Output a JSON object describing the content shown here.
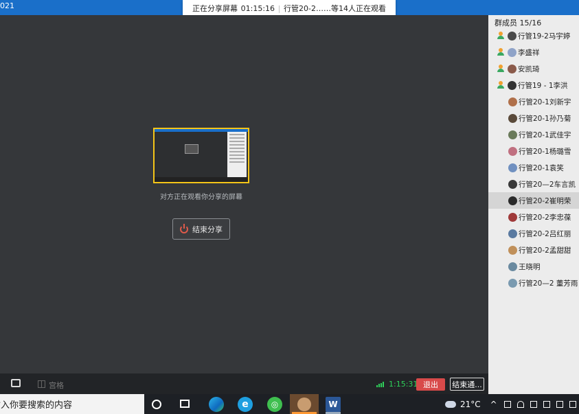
{
  "window": {
    "title_fragment": "021"
  },
  "share_banner": {
    "status": "正在分享屏幕",
    "elapsed": "01:15:16",
    "viewers": "行管20-2……等14人正在观看"
  },
  "stage": {
    "watch_text": "对方正在观看你分享的屏幕",
    "end_share_label": "结束分享"
  },
  "controlbar": {
    "grid_label": "宫格",
    "timer": "1:15:31",
    "leave_label": "退出",
    "end_all_label": "结束通..."
  },
  "sidebar": {
    "header": "群成员 15/16",
    "members": [
      {
        "name": "行管19-2马宇婷",
        "host": true,
        "color": "#4a4a4a"
      },
      {
        "name": "李盛祥",
        "host": true,
        "color": "#8fa3c8"
      },
      {
        "name": "安凯琦",
        "host": true,
        "color": "#8a5a4a"
      },
      {
        "name": "行管19 - 1李洪",
        "host": true,
        "color": "#333333"
      },
      {
        "name": "行管20-1刘新宇",
        "host": false,
        "color": "#b0704a"
      },
      {
        "name": "行管20-1孙乃菊",
        "host": false,
        "color": "#5a4a3a"
      },
      {
        "name": "行管20-1武佳宇",
        "host": false,
        "color": "#6a7a5a"
      },
      {
        "name": "行管20-1杨璐雪",
        "host": false,
        "color": "#c07080"
      },
      {
        "name": "行管20-1袁笑",
        "host": false,
        "color": "#7090c0"
      },
      {
        "name": "行管20—2车言凯",
        "host": false,
        "color": "#3a3a3a"
      },
      {
        "name": "行管20-2崔明荣",
        "host": false,
        "color": "#2a2a2a",
        "selected": true
      },
      {
        "name": "行管20-2李忠葆",
        "host": false,
        "color": "#a03a3a"
      },
      {
        "name": "行管20-2吕红丽",
        "host": false,
        "color": "#5a7aa0"
      },
      {
        "name": "行管20-2孟甜甜",
        "host": false,
        "color": "#c0905a"
      },
      {
        "name": "王晓明",
        "host": false,
        "color": "#6a8aa0"
      },
      {
        "name": "行管20—2 董芳雨",
        "host": false,
        "color": "#7a9ab0"
      }
    ]
  },
  "taskbar": {
    "search_placeholder": "输入你要搜索的内容",
    "ie_glyph": "e",
    "word_glyph": "W",
    "weather": "21°C"
  }
}
